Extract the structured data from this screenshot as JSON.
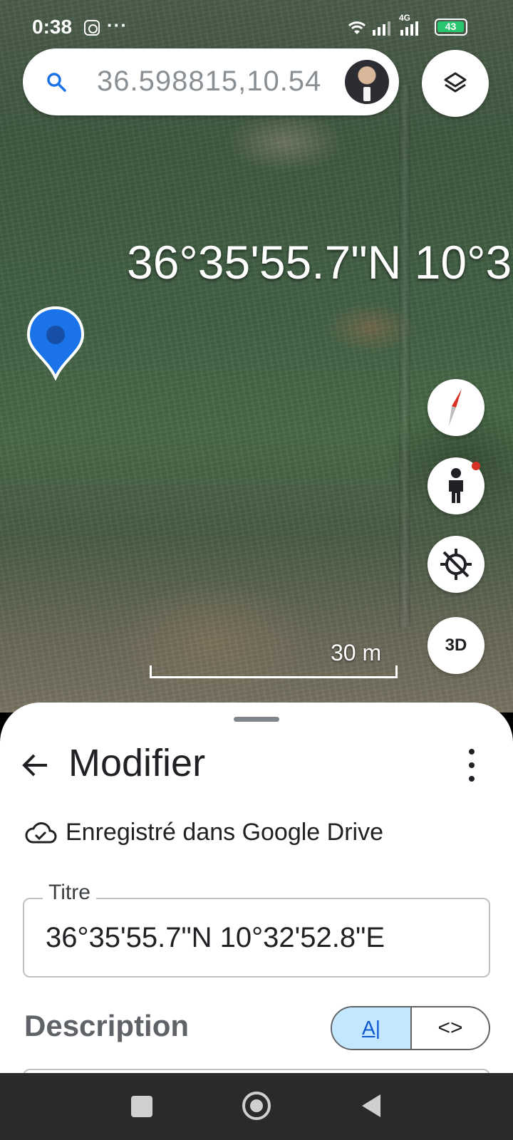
{
  "status_bar": {
    "time": "0:38",
    "dots": "···",
    "network": "4G",
    "battery": "43"
  },
  "search": {
    "query": "36.598815,10.54",
    "icon": "search-icon"
  },
  "map": {
    "coordinate_label": "36°35'55.7\"N 10°3",
    "scale_label": "30 m",
    "threed_label": "3D",
    "colors": {
      "pin": "#1a73e8",
      "accent_red": "#d93025"
    }
  },
  "sheet": {
    "title": "Modifier",
    "save_status": "Enregistré dans Google Drive",
    "title_field_label": "Titre",
    "title_field_value": "36°35'55.7\"N 10°32'52.8\"E",
    "description_label": "Description",
    "format_text": "A|",
    "format_html": "<>"
  }
}
